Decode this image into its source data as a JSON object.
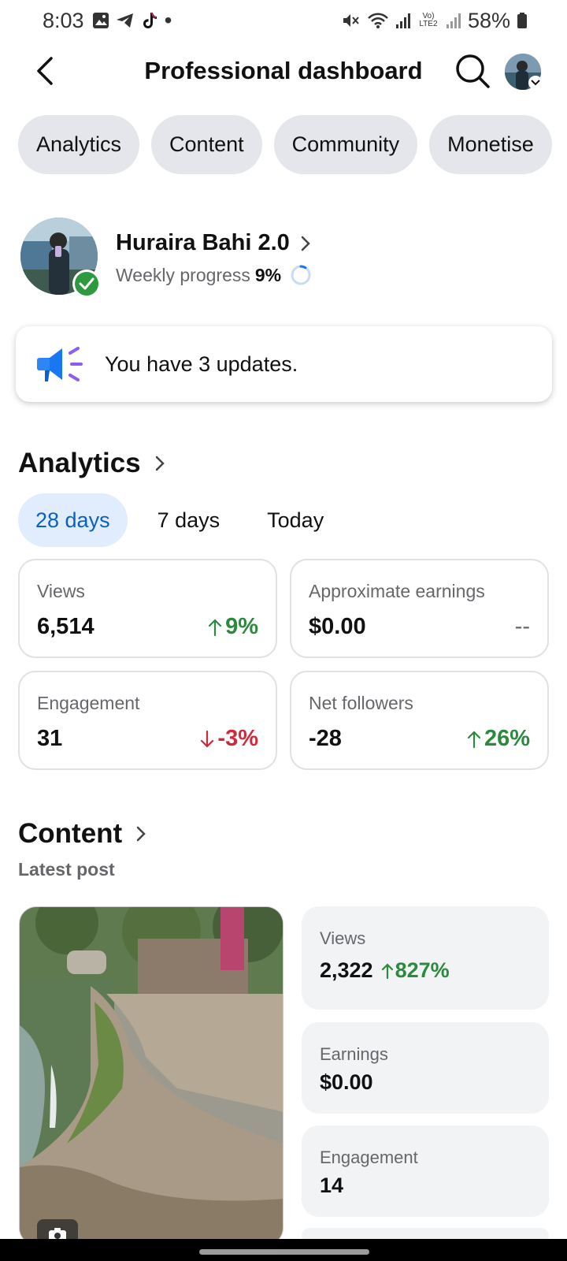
{
  "status_bar": {
    "time": "8:03",
    "battery": "58%",
    "network_label": "Vo) LTE2"
  },
  "header": {
    "title": "Professional dashboard"
  },
  "tabs": [
    {
      "label": "Analytics"
    },
    {
      "label": "Content"
    },
    {
      "label": "Community"
    },
    {
      "label": "Monetise"
    }
  ],
  "profile": {
    "name": "Huraira Bahi 2.0",
    "progress_label": "Weekly progress",
    "progress_value": "9%",
    "progress_fraction": 0.09
  },
  "updates": {
    "text": "You have 3 updates."
  },
  "analytics": {
    "title": "Analytics",
    "ranges": [
      {
        "label": "28 days",
        "active": true
      },
      {
        "label": "7 days",
        "active": false
      },
      {
        "label": "Today",
        "active": false
      }
    ],
    "stats": [
      {
        "label": "Views",
        "value": "6,514",
        "delta": "9%",
        "direction": "up"
      },
      {
        "label": "Approximate earnings",
        "value": "$0.00",
        "delta": "--",
        "direction": "none"
      },
      {
        "label": "Engagement",
        "value": "31",
        "delta": "-3%",
        "direction": "down"
      },
      {
        "label": "Net followers",
        "value": "-28",
        "delta": "26%",
        "direction": "up"
      }
    ]
  },
  "content": {
    "title": "Content",
    "latest_post_label": "Latest post",
    "post_stats": [
      {
        "label": "Views",
        "value": "2,322",
        "delta": "827%"
      },
      {
        "label": "Earnings",
        "value": "$0.00"
      },
      {
        "label": "Engagement",
        "value": "14"
      }
    ]
  },
  "colors": {
    "accent_blue": "#0a5fc5",
    "positive_green": "#2b8a3e",
    "negative_red": "#d1283a",
    "chip_gray": "#e4e6eb"
  }
}
